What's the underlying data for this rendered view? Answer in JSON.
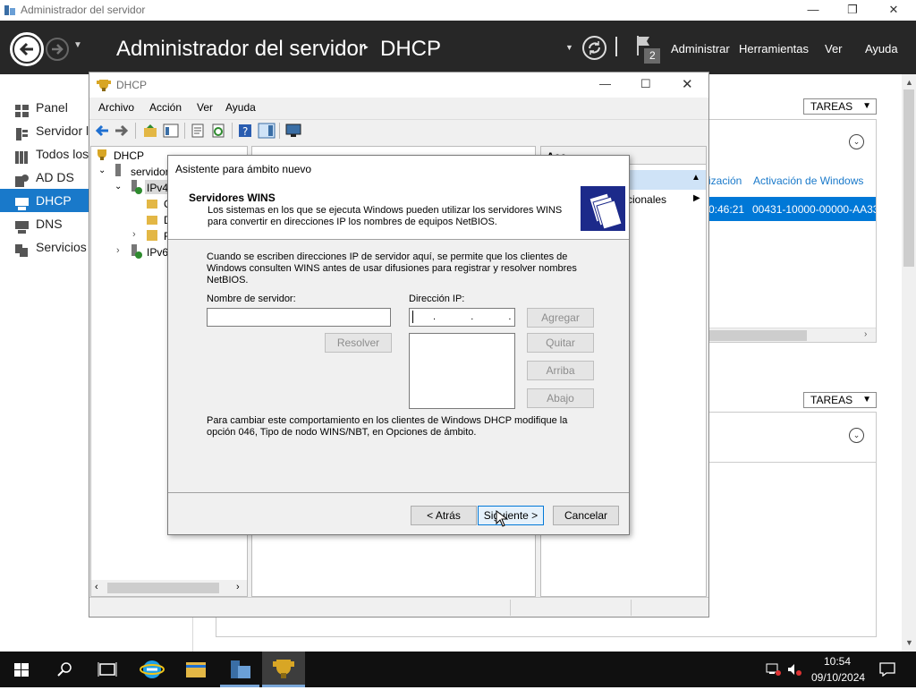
{
  "window": {
    "title": "Administrador del servidor"
  },
  "header": {
    "breadcrumb_root": "Administrador del servidor",
    "breadcrumb_sep": "‣",
    "breadcrumb_current": "DHCP",
    "flag_count": "2",
    "menu": [
      "Administrar",
      "Herramientas",
      "Ver",
      "Ayuda"
    ]
  },
  "sidebar": {
    "items": [
      {
        "label": "Panel",
        "icon": "dashboard-icon"
      },
      {
        "label": "Servidor l",
        "icon": "server-icon"
      },
      {
        "label": "Todos los",
        "icon": "servers-icon"
      },
      {
        "label": "AD DS",
        "icon": "ad-ds-icon"
      },
      {
        "label": "DHCP",
        "icon": "dhcp-icon",
        "active": true
      },
      {
        "label": "DNS",
        "icon": "dns-icon"
      },
      {
        "label": "Servicios d",
        "icon": "file-services-icon"
      }
    ]
  },
  "right_panels": {
    "tareas_label": "TAREAS",
    "col_headers": [
      "ización",
      "Activación de Windows"
    ],
    "row": {
      "time": "0:46:21",
      "activation": "00431-10000-00000-AA33"
    }
  },
  "dhcp_window": {
    "title": "DHCP",
    "menu": [
      "Archivo",
      "Acción",
      "Ver",
      "Ayuda"
    ],
    "tree": {
      "root": "DHCP",
      "server": "servidor",
      "ipv4": "IPv4",
      "ipv4_children": [
        "C",
        "D",
        "F"
      ],
      "ipv6": "IPv6"
    },
    "actions_title": "Acc",
    "actions_more": "cionales"
  },
  "wizard": {
    "title": "Asistente para ámbito nuevo",
    "heading": "Servidores WINS",
    "subheading": "Los sistemas en los que se ejecuta Windows pueden utilizar los servidores WINS para convertir en direcciones IP los nombres de equipos NetBIOS.",
    "intro": "Cuando se escriben direcciones IP de servidor aquí, se permite que los clientes de Windows consulten WINS antes de usar difusiones para registrar y resolver nombres NetBIOS.",
    "server_name_label": "Nombre de servidor:",
    "server_name_value": "",
    "ip_label": "Dirección IP:",
    "ip_value": " .  .  . ",
    "buttons": {
      "resolve": "Resolver",
      "add": "Agregar",
      "remove": "Quitar",
      "up": "Arriba",
      "down": "Abajo",
      "back": "< Atrás",
      "next": "Siguiente >",
      "cancel": "Cancelar"
    },
    "footer_note": "Para cambiar este comportamiento en los clientes de Windows DHCP modifique la opción 046, Tipo de nodo WINS/NBT, en Opciones de ámbito."
  },
  "taskbar": {
    "time": "10:54",
    "date": "09/10/2024",
    "icons": [
      "start-icon",
      "search-icon",
      "task-view-icon",
      "internet-explorer-icon",
      "file-explorer-icon",
      "server-manager-icon",
      "dhcp-icon"
    ]
  },
  "colors": {
    "accent": "#1979ca",
    "header_bg": "#272727",
    "taskbar_bg": "#101010",
    "selection": "#0078d7"
  }
}
